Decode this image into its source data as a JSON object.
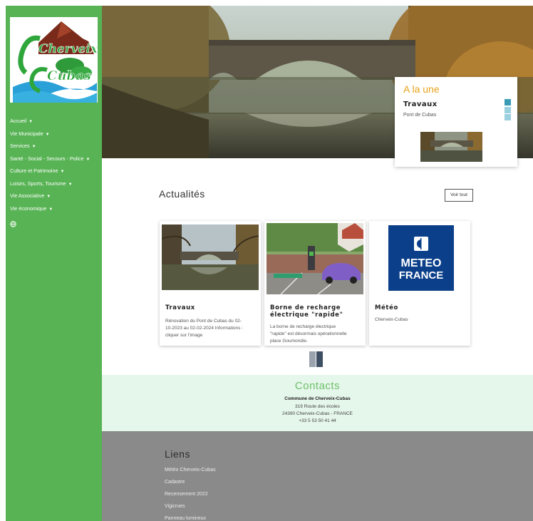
{
  "logo": {
    "line1": "Cherveix",
    "line2": "Cubas"
  },
  "menu": [
    {
      "label": "Accueil"
    },
    {
      "label": "Vie Municipale"
    },
    {
      "label": "Services"
    },
    {
      "label": "Santé - Social - Secours - Police"
    },
    {
      "label": "Culture et Patrimoine"
    },
    {
      "label": "Loisirs, Sports, Tourisme"
    },
    {
      "label": "Vie Associative"
    },
    {
      "label": "Vie économique"
    }
  ],
  "featured": {
    "section": "A la une",
    "title": "Travaux",
    "subtitle": "Pont de Cubas",
    "slides_total": 3,
    "slide_active": 1
  },
  "news": {
    "title": "Actualités",
    "see_all": "Voir tout",
    "cards": [
      {
        "title": "Travaux",
        "text": [
          "Rénovation du Pont de Cubas du 02-",
          "10-2023 au 02-02-2024 Informations :",
          "cliquer sur l'image"
        ]
      },
      {
        "title_lines": [
          "Borne de recharge",
          "électrique \"rapide\""
        ],
        "text": [
          "La borne de recharge électrique",
          "\"rapide\" est désormais opérationnelle",
          "place Goumondie."
        ]
      },
      {
        "title": "Météo",
        "text": [
          "Cherveix-Cubas"
        ],
        "logo_lines": [
          "METEO",
          "FRANCE"
        ]
      }
    ],
    "pager": {
      "pages": 2,
      "active": 2
    }
  },
  "contacts": {
    "title": "Contacts",
    "name": "Commune de Cherveix-Cubas",
    "street": "319 Route des écoles",
    "city": "24390 Cherveix-Cubas - FRANCE",
    "phone": "+33 5 53 50 41 44"
  },
  "liens": {
    "title": "Liens",
    "items": [
      "Météo Cherveix-Cubas",
      "Cadastre",
      "Recensement 2022",
      "Vigicrues",
      "Panneau lumineux"
    ]
  },
  "colors": {
    "sidebar": "#57b354",
    "accent_orange": "#e6a21a",
    "contacts_bg": "#e5f6ea",
    "contacts_title": "#6fc06b",
    "liens_bg": "#8a8a8a",
    "meteo_blue": "#0b3f8a"
  }
}
